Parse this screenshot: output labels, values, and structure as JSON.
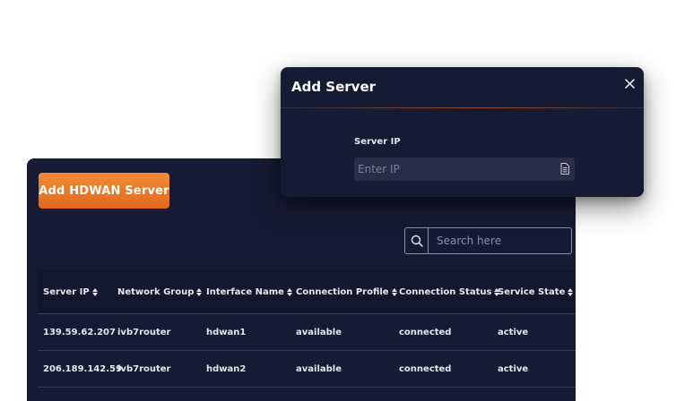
{
  "main": {
    "add_button_label": "Add HDWAN Server",
    "search": {
      "placeholder": "Search here",
      "icon": "search-icon"
    },
    "table": {
      "columns": [
        "Server IP",
        "Network Group",
        "Interface Name",
        "Connection Profile",
        "Connection Status",
        "Service State"
      ],
      "rows": [
        [
          "139.59.62.207",
          "ivb7router",
          "hdwan1",
          "available",
          "connected",
          "active"
        ],
        [
          "206.189.142.59",
          "ivb7router",
          "hdwan2",
          "available",
          "connected",
          "active"
        ]
      ]
    }
  },
  "dialog": {
    "title": "Add Server",
    "field_label": "Server IP",
    "field_placeholder": "Enter IP",
    "close_icon": "close-icon",
    "field_icon": "document-icon"
  },
  "colors": {
    "panel_bg": "#171a33",
    "accent": "#e87a2a",
    "text": "#e6e7ef"
  }
}
